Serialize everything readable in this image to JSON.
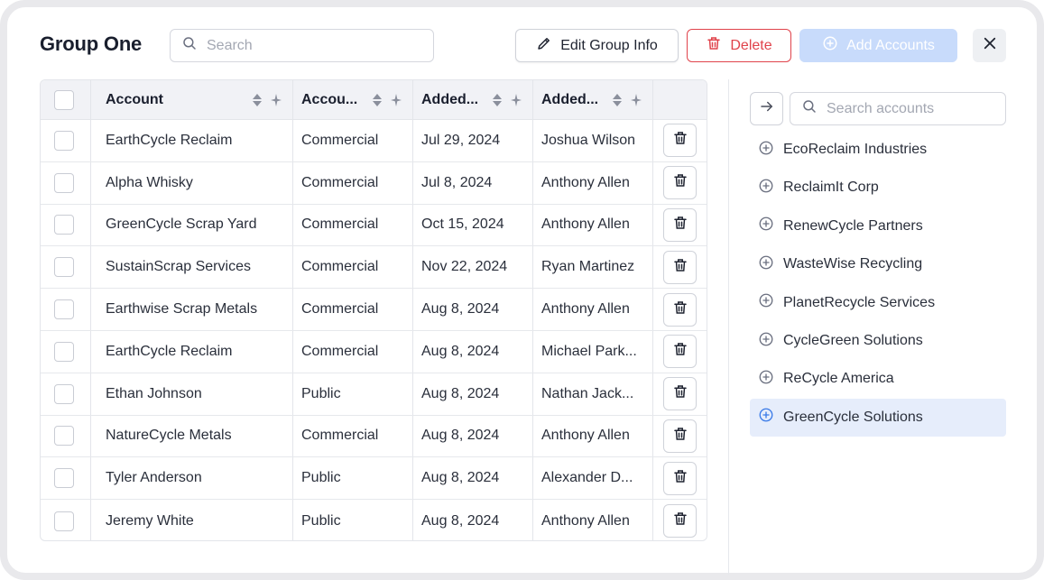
{
  "title": "Group One",
  "search": {
    "placeholder": "Search"
  },
  "buttons": {
    "edit": "Edit Group Info",
    "delete": "Delete",
    "add": "Add Accounts"
  },
  "table": {
    "columns": [
      "Account",
      "Accou...",
      "Added...",
      "Added..."
    ],
    "rows": [
      {
        "account": "EarthCycle Reclaim",
        "type": "Commercial",
        "date": "Jul 29, 2024",
        "by": "Joshua Wilson"
      },
      {
        "account": "Alpha Whisky",
        "type": "Commercial",
        "date": "Jul 8, 2024",
        "by": "Anthony Allen"
      },
      {
        "account": "GreenCycle Scrap Yard",
        "type": "Commercial",
        "date": "Oct 15, 2024",
        "by": "Anthony Allen"
      },
      {
        "account": "SustainScrap Services",
        "type": "Commercial",
        "date": "Nov 22, 2024",
        "by": "Ryan Martinez"
      },
      {
        "account": "Earthwise Scrap Metals",
        "type": "Commercial",
        "date": "Aug 8, 2024",
        "by": "Anthony Allen"
      },
      {
        "account": "EarthCycle Reclaim",
        "type": "Commercial",
        "date": "Aug 8, 2024",
        "by": "Michael Park..."
      },
      {
        "account": "Ethan Johnson",
        "type": "Public",
        "date": "Aug 8, 2024",
        "by": "Nathan Jack..."
      },
      {
        "account": "NatureCycle Metals",
        "type": "Commercial",
        "date": "Aug 8, 2024",
        "by": "Anthony Allen"
      },
      {
        "account": "Tyler Anderson",
        "type": "Public",
        "date": "Aug 8, 2024",
        "by": "Alexander D..."
      },
      {
        "account": "Jeremy White",
        "type": "Public",
        "date": "Aug 8, 2024",
        "by": "Anthony Allen"
      }
    ]
  },
  "account_search": {
    "placeholder": "Search accounts"
  },
  "available_accounts": [
    {
      "name": "EcoReclaim Industries",
      "selected": false
    },
    {
      "name": "ReclaimIt Corp",
      "selected": false
    },
    {
      "name": "RenewCycle Partners",
      "selected": false
    },
    {
      "name": "WasteWise Recycling",
      "selected": false
    },
    {
      "name": "PlanetRecycle Services",
      "selected": false
    },
    {
      "name": "CycleGreen Solutions",
      "selected": false
    },
    {
      "name": "ReCycle America",
      "selected": false
    },
    {
      "name": "GreenCycle Solutions",
      "selected": true
    }
  ],
  "colors": {
    "delete": "#e0434b",
    "add_disabled": "#c8dbfb",
    "selected_row": "#e6edfb",
    "accent": "#3b7be8"
  },
  "icons": [
    "search-icon",
    "pencil-icon",
    "trash-icon",
    "plus-circle-icon",
    "close-icon",
    "sort-icon",
    "pin-icon",
    "arrow-right-icon"
  ]
}
